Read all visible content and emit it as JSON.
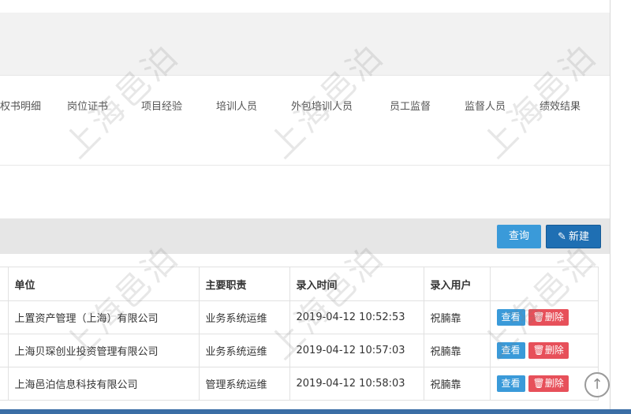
{
  "tabs": [
    {
      "label": "权书明细"
    },
    {
      "label": "岗位证书"
    },
    {
      "label": "项目经验"
    },
    {
      "label": "培训人员"
    },
    {
      "label": "外包培训人员"
    },
    {
      "label": "员工监督"
    },
    {
      "label": "监督人员"
    },
    {
      "label": "绩效结果"
    }
  ],
  "toolbar": {
    "query_label": "查询",
    "new_label": "新建",
    "new_icon": "pencil-icon"
  },
  "table": {
    "headers": [
      "单位",
      "主要职责",
      "录入时间",
      "录入用户",
      ""
    ],
    "rows": [
      {
        "unit": "上置资产管理（上海）有限公司",
        "duty": "业务系统运维",
        "time": "2019-04-12 10:52:53",
        "user": "祝腩靠",
        "view": "查看",
        "del": "删除"
      },
      {
        "unit": "上海贝琛创业投资管理有限公司",
        "duty": "业务系统运维",
        "time": "2019-04-12 10:57:03",
        "user": "祝腩靠",
        "view": "查看",
        "del": "删除"
      },
      {
        "unit": "上海邑泊信息科技有限公司",
        "duty": "管理系统运维",
        "time": "2019-04-12 10:58:03",
        "user": "祝腩靠",
        "view": "查看",
        "del": "删除"
      }
    ]
  },
  "back_to_top_icon": "arrow-up-circle-icon",
  "watermark_text": "上海邑泊",
  "colors": {
    "query": "#3a9ad9",
    "new": "#1f6fb3",
    "delete": "#e7505a"
  }
}
